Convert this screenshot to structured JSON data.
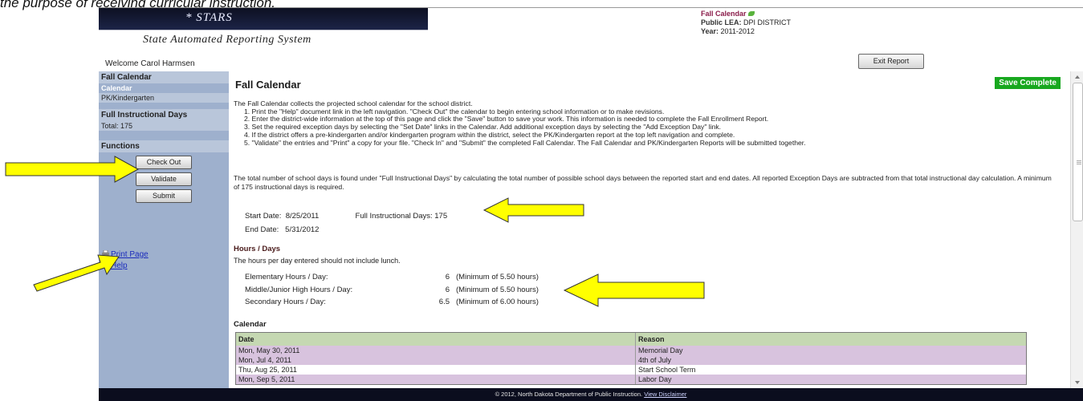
{
  "caption": "the purpose of receiving curricular instruction.",
  "header": {
    "brand_word": "* STARS",
    "system_name": "State Automated Reporting System",
    "welcome": "Welcome Carol Harmsen",
    "report_title": "Fall Calendar",
    "lea_label": "Public LEA:",
    "lea_value": "DPI DISTRICT",
    "year_label": "Year:",
    "year_value": "2011-2012",
    "exit_label": "Exit Report"
  },
  "sidebar": {
    "section1_title": "Fall Calendar",
    "items": [
      {
        "label": "Calendar"
      },
      {
        "label": "PK/Kindergarten"
      }
    ],
    "instr_title": "Full Instructional Days",
    "instr_total": "Total: 175",
    "functions_title": "Functions",
    "buttons": [
      "Check Out",
      "Validate",
      "Submit"
    ],
    "links": [
      "Print Page",
      "Help"
    ]
  },
  "main": {
    "title": "Fall Calendar",
    "status_badge": "Save Complete",
    "intro": "The Fall Calendar collects the projected school calendar for the school district.",
    "steps": [
      "1. Print the \"Help\" document link in the left navigation. \"Check Out\" the calendar to begin entering school information or to make revisions.",
      "2. Enter the district-wide information at the top of this page and click the \"Save\" button to save your work. This information is needed to complete the Fall Enrollment Report.",
      "3. Set the required exception days by selecting the \"Set Date\" links in the Calendar. Add additional exception days by selecting the \"Add Exception Day\" link.",
      "4. If the district offers a pre-kindergarten and/or kindergarten program within the district, select the PK/Kindergarten report at the top left navigation and complete.",
      "5. \"Validate\" the entries and \"Print\" a copy for your file. \"Check In\" and \"Submit\" the completed Fall Calendar. The Fall Calendar and PK/Kindergarten Reports will be submitted together."
    ],
    "para2": "The total number of school days is found under \"Full Instructional Days\" by calculating the total number of possible school days between the reported start and end dates. All reported Exception Days are subtracted from that total instructional day calculation. A minimum of 175 instructional days is required.",
    "start_label": "Start Date:",
    "start_value": "8/25/2011",
    "end_label": "End Date:",
    "end_value": "5/31/2012",
    "fid_label": "Full Instructional Days: 175",
    "hours_title": "Hours / Days",
    "hours_note": "The hours per day entered should not include lunch.",
    "hours": [
      {
        "label": "Elementary Hours / Day:",
        "value": "6",
        "min": "(Minimum of 5.50 hours)"
      },
      {
        "label": "Middle/Junior High Hours / Day:",
        "value": "6",
        "min": "(Minimum of 5.50 hours)"
      },
      {
        "label": "Secondary Hours / Day:",
        "value": "6.5",
        "min": "(Minimum of 6.00 hours)"
      }
    ],
    "calendar_title": "Calendar",
    "calendar_headers": [
      "Date",
      "Reason"
    ],
    "calendar_rows": [
      {
        "date": "Mon, May 30, 2011",
        "reason": "Memorial Day"
      },
      {
        "date": "Mon, Jul 4, 2011",
        "reason": "4th of July"
      },
      {
        "date": "Thu, Aug 25, 2011",
        "reason": "Start School Term"
      },
      {
        "date": "Mon, Sep 5, 2011",
        "reason": "Labor Day"
      }
    ]
  },
  "footer": {
    "text": "© 2012, North Dakota Department of Public Instruction.",
    "link": "View Disclaimer"
  },
  "colors": {
    "arrow_fill": "#ffff00",
    "save_badge": "#18a81f",
    "sidebar_bg": "#9eb0cd",
    "table_header": "#c5d8b2",
    "row_mauve": "#d8c3de"
  }
}
